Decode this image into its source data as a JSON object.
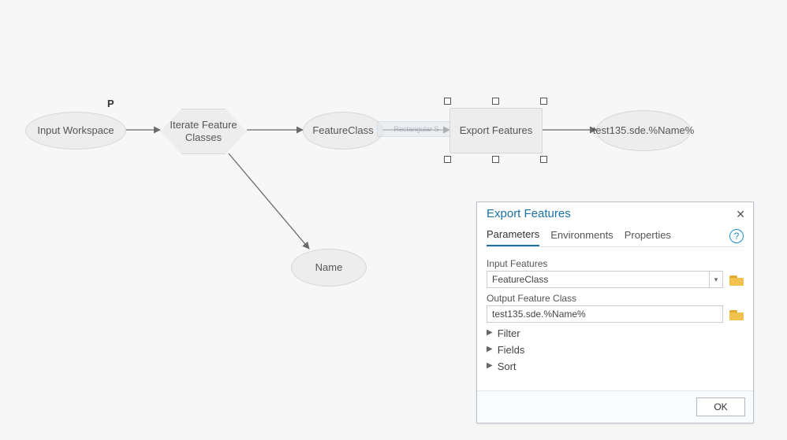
{
  "model": {
    "parameter_badge": "P",
    "nodes": {
      "input_workspace": "Input Workspace",
      "iterate_feature_classes": "Iterate Feature Classes",
      "feature_class": "FeatureClass",
      "name": "Name",
      "export_features": "Export Features",
      "output": "test135.sde.%Name%",
      "ghost_label": "Rectangular S"
    }
  },
  "dialog": {
    "title": "Export Features",
    "close_glyph": "✕",
    "help_glyph": "?",
    "tabs": {
      "parameters": "Parameters",
      "environments": "Environments",
      "properties": "Properties"
    },
    "fields": {
      "input_features_label": "Input Features",
      "input_features_value": "FeatureClass",
      "output_fc_label": "Output Feature Class",
      "output_fc_value": "test135.sde.%Name%"
    },
    "expanders": {
      "filter": "Filter",
      "fields": "Fields",
      "sort": "Sort"
    },
    "ok": "OK"
  }
}
